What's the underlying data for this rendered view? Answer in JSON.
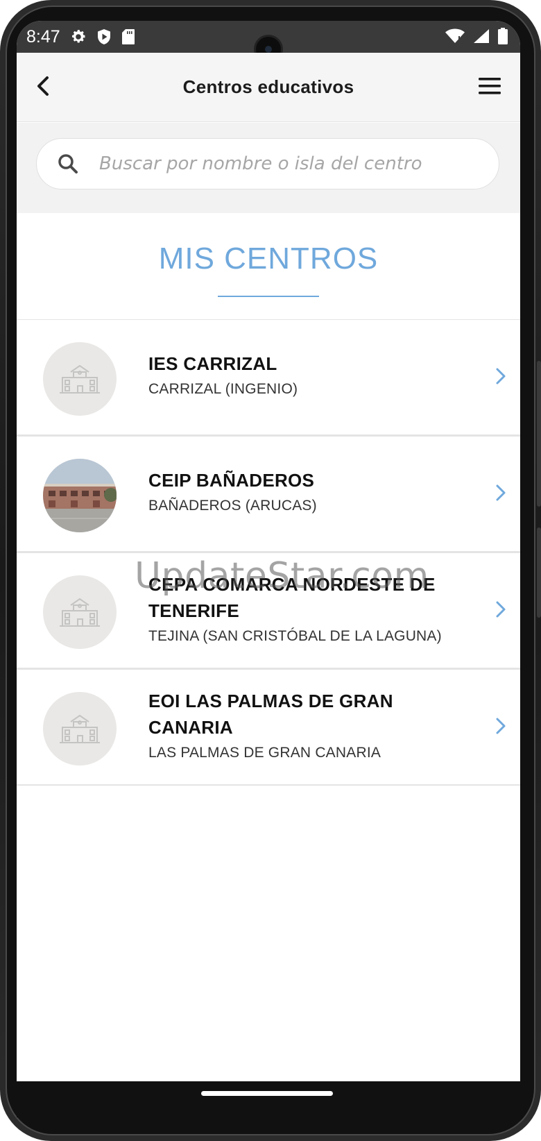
{
  "status_bar": {
    "time": "8:47",
    "left_icons": [
      "gear-icon",
      "shield-play-icon",
      "sd-card-icon"
    ],
    "right_icons": [
      "wifi-icon",
      "signal-icon",
      "battery-icon"
    ]
  },
  "header": {
    "title": "Centros educativos",
    "back_icon": "chevron-left-icon",
    "menu_icon": "hamburger-menu-icon"
  },
  "search": {
    "placeholder": "Buscar por nombre o isla del centro",
    "value": ""
  },
  "section": {
    "title": "MIS CENTROS"
  },
  "centers": [
    {
      "name": "IES CARRIZAL",
      "location": "CARRIZAL (INGENIO)",
      "image": "school-building-icon"
    },
    {
      "name": "CEIP BAÑADEROS",
      "location": "BAÑADEROS (ARUCAS)",
      "image": "school-photo"
    },
    {
      "name": "CEPA COMARCA NORDESTE DE TENERIFE",
      "location": "TEJINA (SAN CRISTÓBAL DE LA LAGUNA)",
      "image": "school-building-icon"
    },
    {
      "name": "EOI LAS PALMAS DE GRAN CANARIA",
      "location": "LAS PALMAS DE GRAN CANARIA",
      "image": "school-building-icon"
    }
  ],
  "watermark": "UpdateStar.com",
  "colors": {
    "accent": "#6fa8dc",
    "header_bg": "#f5f5f5",
    "status_bar_bg": "#3a3a3a"
  }
}
